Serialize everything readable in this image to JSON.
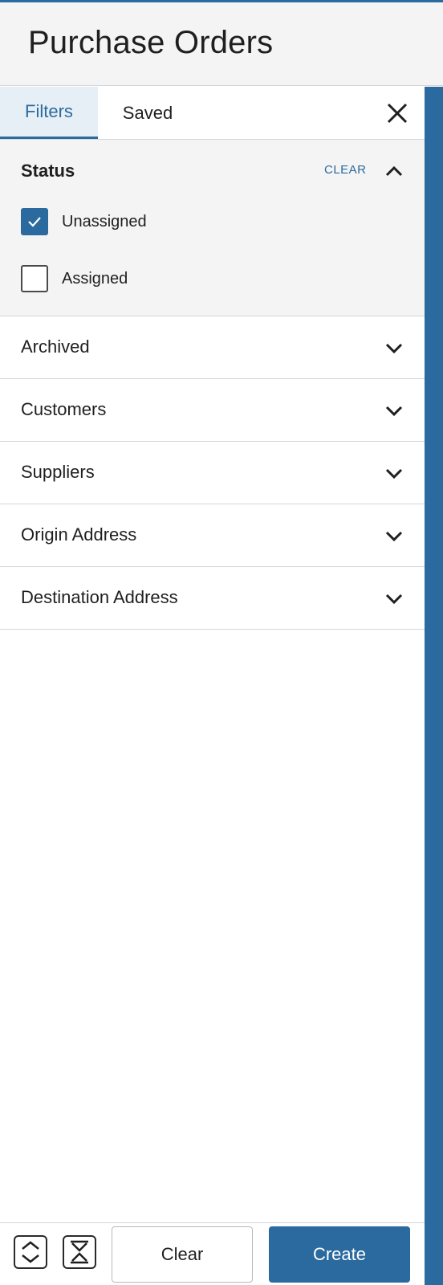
{
  "header": {
    "title": "Purchase Orders"
  },
  "tabs": [
    {
      "label": "Filters",
      "active": true
    },
    {
      "label": "Saved",
      "active": false
    }
  ],
  "icons": {
    "close": "close-icon",
    "collapse_section": "chevron-up-icon",
    "expand_section": "chevron-down-icon",
    "checkmark": "checkmark-icon",
    "expand_all": "expand-all-icon",
    "collapse_all": "collapse-all-icon"
  },
  "colors": {
    "accent": "#2b6a9e",
    "panel_bg": "#f4f4f4",
    "divider": "#d6d6d6"
  },
  "status": {
    "title": "Status",
    "clear_label": "CLEAR",
    "options": [
      {
        "label": "Unassigned",
        "checked": true
      },
      {
        "label": "Assigned",
        "checked": false
      }
    ]
  },
  "sections": [
    {
      "label": "Archived"
    },
    {
      "label": "Customers"
    },
    {
      "label": "Suppliers"
    },
    {
      "label": "Origin Address"
    },
    {
      "label": "Destination Address"
    }
  ],
  "footer": {
    "clear_label": "Clear",
    "create_label": "Create"
  }
}
